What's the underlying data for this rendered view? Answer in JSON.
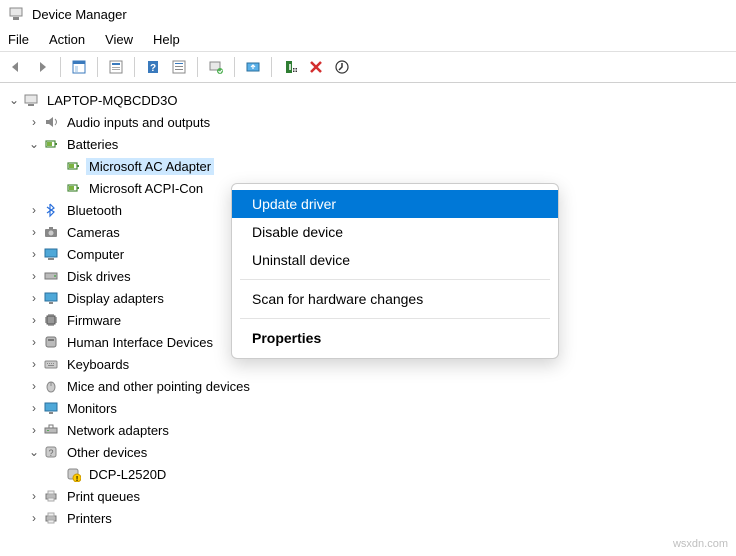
{
  "window": {
    "title": "Device Manager"
  },
  "menu": {
    "file": "File",
    "action": "Action",
    "view": "View",
    "help": "Help"
  },
  "tree": {
    "root": "LAPTOP-MQBCDD3O",
    "audio": "Audio inputs and outputs",
    "batteries": "Batteries",
    "ac_adapter": "Microsoft AC Adapter",
    "acpi": "Microsoft ACPI-Con",
    "bluetooth": "Bluetooth",
    "cameras": "Cameras",
    "computer": "Computer",
    "disk": "Disk drives",
    "display": "Display adapters",
    "firmware": "Firmware",
    "hid": "Human Interface Devices",
    "keyboards": "Keyboards",
    "mice": "Mice and other pointing devices",
    "monitors": "Monitors",
    "network": "Network adapters",
    "other": "Other devices",
    "dcp": "DCP-L2520D",
    "print_queues": "Print queues",
    "printers": "Printers"
  },
  "context_menu": {
    "update": "Update driver",
    "disable": "Disable device",
    "uninstall": "Uninstall device",
    "scan": "Scan for hardware changes",
    "properties": "Properties"
  },
  "watermark": "wsxdn.com"
}
